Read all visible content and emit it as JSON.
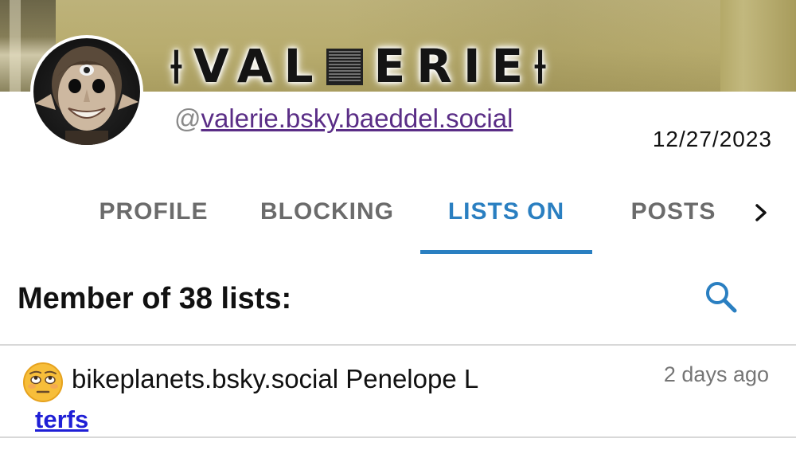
{
  "profile": {
    "display_name_left": "⟊VAL",
    "display_name_right": "ERIE⟊",
    "handle_prefix": "@",
    "handle": "valerie.bsky.baeddel.social",
    "date": "12/27/2023"
  },
  "tabs": [
    {
      "label": "PROFILE",
      "active": false
    },
    {
      "label": "BLOCKING",
      "active": false
    },
    {
      "label": "LISTS ON",
      "active": true
    },
    {
      "label": "POSTS",
      "active": false
    }
  ],
  "tabs_more_icon": "chevron-right-icon",
  "lists": {
    "heading": "Member of 38 lists:",
    "search_icon": "search-icon",
    "items": [
      {
        "emoji": "face-with-rolling-eyes-icon",
        "user": "bikeplanets.bsky.social Penelope L",
        "time": "2 days ago",
        "list_name": "terfs"
      }
    ]
  },
  "colors": {
    "accent": "#2a7fc1",
    "handle_link": "#5a2d86",
    "list_link": "#1f1fd6",
    "muted": "#6b6b6b"
  }
}
